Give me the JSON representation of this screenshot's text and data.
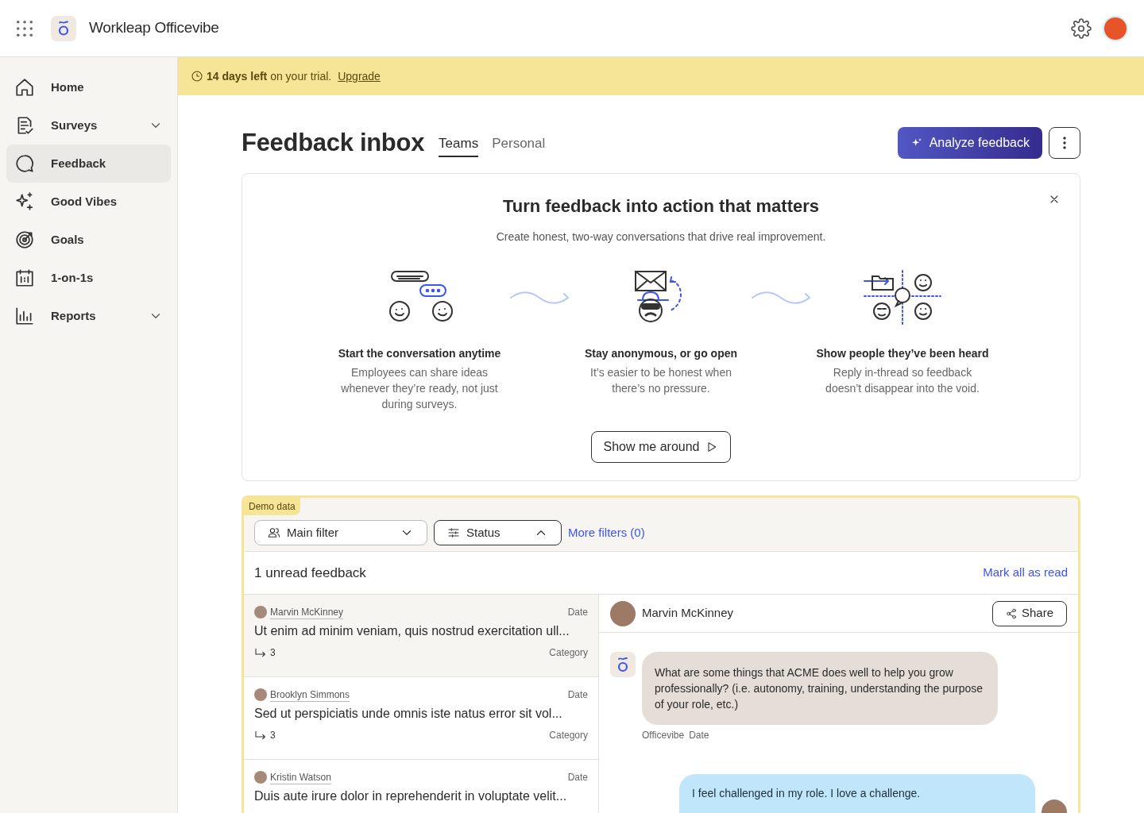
{
  "header": {
    "app_name": "Workleap Officevibe"
  },
  "sidebar": {
    "items": [
      {
        "label": "Home",
        "selected": false,
        "has_submenu": false
      },
      {
        "label": "Surveys",
        "selected": false,
        "has_submenu": true
      },
      {
        "label": "Feedback",
        "selected": true,
        "has_submenu": false
      },
      {
        "label": "Good Vibes",
        "selected": false,
        "has_submenu": false
      },
      {
        "label": "Goals",
        "selected": false,
        "has_submenu": false
      },
      {
        "label": "1-on-1s",
        "selected": false,
        "has_submenu": false
      },
      {
        "label": "Reports",
        "selected": false,
        "has_submenu": true
      }
    ]
  },
  "trial_banner": {
    "text": "**14 days left** on your trial.",
    "link": "Upgrade"
  },
  "page": {
    "title": "Feedback inbox",
    "tabs": [
      {
        "label": "Teams",
        "selected": true
      },
      {
        "label": "Personal",
        "selected": false
      }
    ],
    "primary_button": "Analyze feedback"
  },
  "intro_card": {
    "title": "Turn feedback into action that matters",
    "subtitle": "Create honest, two-way conversations that drive real improvement.",
    "steps": [
      {
        "kind": "conversation",
        "title": "Start the conversation anytime",
        "text": "Employees can share ideas whenever they’re ready, not just during surveys."
      },
      {
        "kind": "anonymous",
        "title": "Stay anonymous, or go open",
        "text": "It’s easier to be honest when there’s no pressure."
      },
      {
        "kind": "heard",
        "title": "Show people they’ve been heard",
        "text": "Reply in-thread so feedback doesn’t disappear into the void."
      }
    ],
    "button": "Show me around"
  },
  "inbox": {
    "badge": "Demo data",
    "filters": [
      {
        "kind": "people",
        "label": "Main filter",
        "expanded": false
      },
      {
        "kind": "sliders",
        "label": "Status",
        "expanded": true
      }
    ],
    "more_filters": "More filters (0)",
    "unread_count": "1 unread feedback",
    "mark_all_read": "Mark all as read",
    "items": [
      {
        "author": "Marvin McKinney",
        "date": "Date",
        "text": "Ut enim ad minim veniam, quis nostrud exercitation ull...",
        "replies": "3",
        "category": "Category",
        "selected": true
      },
      {
        "author": "Brooklyn Simmons",
        "date": "Date",
        "text": "Sed ut perspiciatis unde omnis iste natus error sit vol...",
        "replies": "3",
        "category": "Category",
        "selected": false
      },
      {
        "author": "Kristin Watson",
        "date": "Date",
        "text": "Duis aute irure dolor in reprehenderit in voluptate velit...",
        "selected": false
      }
    ],
    "conversation": {
      "author": "Marvin McKinney",
      "share": "Share",
      "messages": [
        {
          "kind": "question",
          "text": "What are some things that ACME does well to help you grow professionally? (i.e. autonomy, training, understanding the purpose of your role, etc.)",
          "sender": "Officevibe",
          "date": "Date"
        },
        {
          "kind": "reply",
          "text": "I feel challenged in my role. I love a challenge."
        }
      ]
    }
  }
}
